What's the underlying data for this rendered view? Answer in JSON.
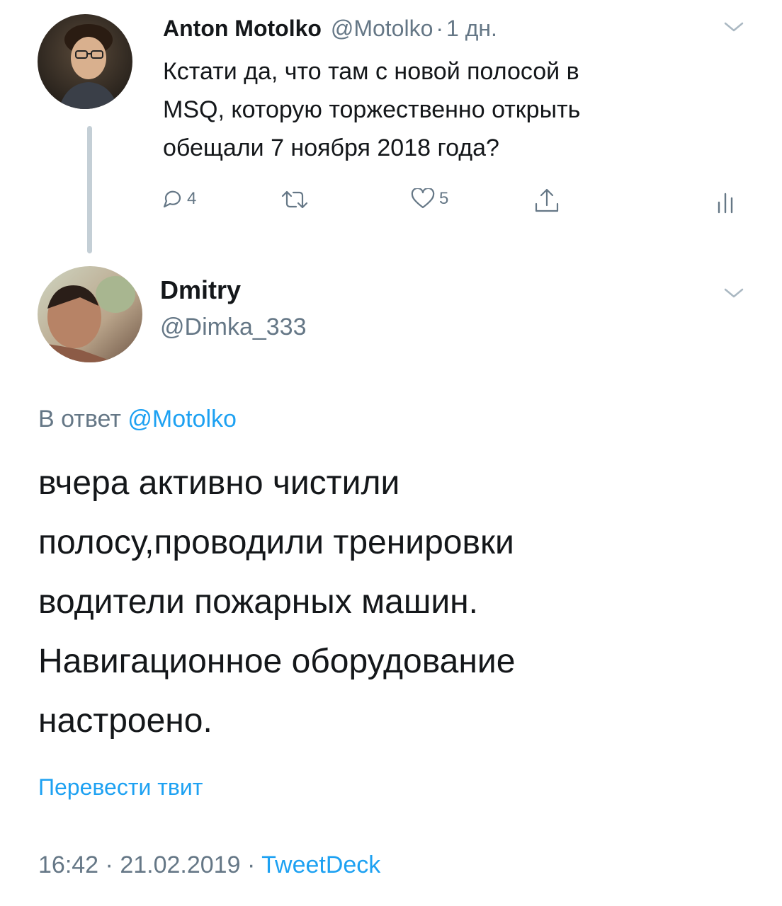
{
  "colors": {
    "text": "#14171a",
    "muted": "#657786",
    "link": "#1da1f2",
    "thread_line": "#c4cfd6"
  },
  "parent_tweet": {
    "author_name": "Anton Motolko",
    "handle": "@Motolko",
    "separator": "·",
    "time_ago": "1 дн.",
    "text_lines": [
      "Кстати да, что там с новой полосой в",
      "MSQ, которую торжественно открыть",
      "обещали 7 ноября 2018 года?"
    ],
    "actions": {
      "reply_icon": "reply-icon",
      "reply_count": "4",
      "retweet_icon": "retweet-icon",
      "like_icon": "heart-icon",
      "like_count": "5",
      "share_icon": "share-icon",
      "analytics_icon": "analytics-icon"
    }
  },
  "main_tweet": {
    "author_name": "Dmitry",
    "handle": "@Dimka_333",
    "reply_prefix": "В ответ",
    "reply_to": "@Motolko",
    "text_lines": [
      "вчера активно чистили",
      "полосу,проводили тренировки",
      "водители пожарных машин.",
      "Навигационное оборудование",
      "настроено."
    ],
    "translate_label": "Перевести твит",
    "time": "16:42",
    "separator": "·",
    "date": "21.02.2019",
    "source": "TweetDeck"
  }
}
